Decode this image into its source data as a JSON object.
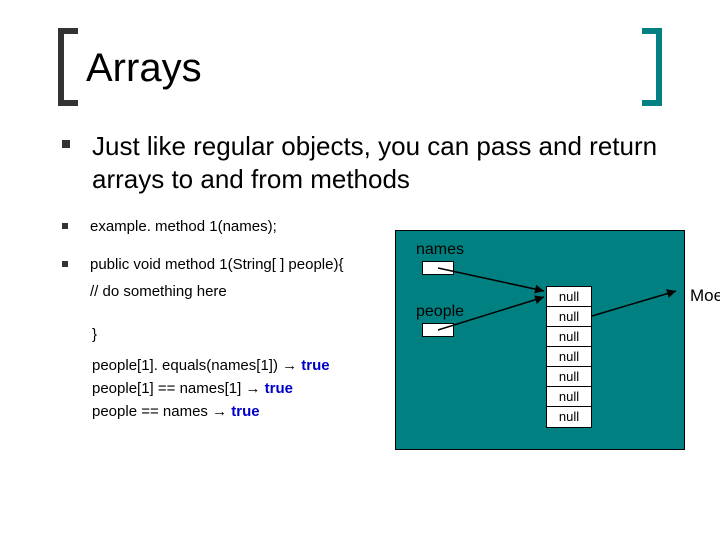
{
  "title": "Arrays",
  "main_bullet": "Just like regular objects, you can pass and return arrays to and from methods",
  "code": {
    "line1": "example. method 1(names);",
    "line2": "public void method 1(String[ ] people){",
    "line3": "// do something here",
    "close": "}"
  },
  "equalities": {
    "eq1_lhs": "people[1]. equals(names[1]) ",
    "eq2_lhs": "people[1] == names[1] ",
    "eq3_lhs": "people == names ",
    "arrow": "→ ",
    "true": "true"
  },
  "diagram": {
    "names_label": "names",
    "people_label": "people",
    "cells": [
      "null",
      "null",
      "null",
      "null",
      "null",
      "null",
      "null"
    ],
    "moe": "Moe"
  }
}
